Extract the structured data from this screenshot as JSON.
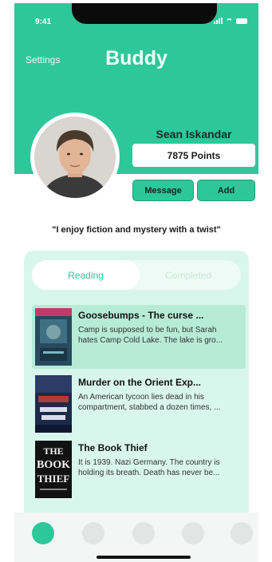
{
  "status": {
    "time": "9:41"
  },
  "header": {
    "settings_label": "Settings",
    "title": "Buddy"
  },
  "profile": {
    "name": "Sean Iskandar",
    "points": "7875 Points",
    "message_label": "Message",
    "add_label": "Add",
    "quote": "\"I enjoy fiction and mystery with a twist\""
  },
  "tabs": {
    "reading": "Reading",
    "completed": "Completed"
  },
  "books": [
    {
      "title": "Goosebumps - The curse ...",
      "description": "Camp is supposed to be fun, but Sarah hates Camp Cold Lake. The lake is gro..."
    },
    {
      "title": "Murder on the Orient Exp...",
      "description": "An American tycoon lies dead in his compartment, stabbed a dozen times, ..."
    },
    {
      "title": "The Book Thief",
      "description": "It is 1939. Nazi Germany. The country is holding its breath. Death has never be...",
      "cover_text": [
        "THE",
        "BOOK",
        "THIEF"
      ]
    }
  ],
  "colors": {
    "accent": "#2ec79a",
    "panel": "#d9f6ec",
    "active_row": "#b6ebd8"
  },
  "icons": [
    "signal-icon",
    "wifi-icon",
    "battery-icon"
  ]
}
